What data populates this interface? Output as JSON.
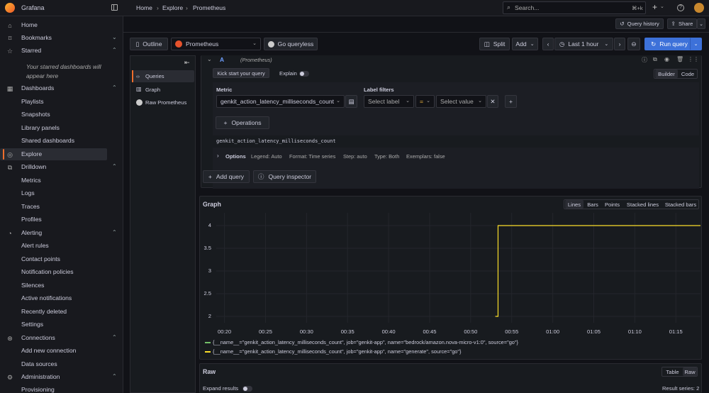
{
  "topbar": {
    "app_name": "Grafana",
    "breadcrumb": [
      "Home",
      "Explore",
      "Prometheus"
    ],
    "search_placeholder": "Search...",
    "search_shortcut": "⌘+k",
    "plus_label": "+"
  },
  "sidebar": {
    "items": [
      {
        "label": "Home",
        "icon": "home-icon",
        "chev": ""
      },
      {
        "label": "Bookmarks",
        "icon": "bookmark-icon",
        "chev": "⌄"
      },
      {
        "label": "Starred",
        "icon": "star-icon",
        "chev": "⌃"
      },
      {
        "label": "Dashboards",
        "icon": "dashboards-icon",
        "chev": "⌃"
      },
      {
        "label": "Playlists",
        "icon": "",
        "chev": ""
      },
      {
        "label": "Snapshots",
        "icon": "",
        "chev": ""
      },
      {
        "label": "Library panels",
        "icon": "",
        "chev": ""
      },
      {
        "label": "Shared dashboards",
        "icon": "",
        "chev": ""
      },
      {
        "label": "Explore",
        "icon": "explore-icon",
        "chev": ""
      },
      {
        "label": "Drilldown",
        "icon": "drilldown-icon",
        "chev": "⌃"
      },
      {
        "label": "Metrics",
        "icon": "",
        "chev": ""
      },
      {
        "label": "Logs",
        "icon": "",
        "chev": ""
      },
      {
        "label": "Traces",
        "icon": "",
        "chev": ""
      },
      {
        "label": "Profiles",
        "icon": "",
        "chev": ""
      },
      {
        "label": "Alerting",
        "icon": "bell-icon",
        "chev": "⌃"
      },
      {
        "label": "Alert rules",
        "icon": "",
        "chev": ""
      },
      {
        "label": "Contact points",
        "icon": "",
        "chev": ""
      },
      {
        "label": "Notification policies",
        "icon": "",
        "chev": ""
      },
      {
        "label": "Silences",
        "icon": "",
        "chev": ""
      },
      {
        "label": "Active notifications",
        "icon": "",
        "chev": ""
      },
      {
        "label": "Recently deleted",
        "icon": "",
        "chev": ""
      },
      {
        "label": "Settings",
        "icon": "",
        "chev": ""
      },
      {
        "label": "Connections",
        "icon": "connections-icon",
        "chev": "⌃"
      },
      {
        "label": "Add new connection",
        "icon": "",
        "chev": ""
      },
      {
        "label": "Data sources",
        "icon": "",
        "chev": ""
      },
      {
        "label": "Administration",
        "icon": "gear-icon",
        "chev": "⌃"
      },
      {
        "label": "Provisioning",
        "icon": "",
        "chev": ""
      }
    ],
    "starred_empty": "Your starred dashboards will appear here"
  },
  "actions": {
    "query_history": "Query history",
    "share": "Share"
  },
  "toolbar": {
    "outline": "Outline",
    "datasource": "Prometheus",
    "go_queryless": "Go queryless",
    "split": "Split",
    "add": "Add",
    "time_range": "Last 1 hour",
    "run_query": "Run query"
  },
  "outline_panel": {
    "items": [
      "Queries",
      "Graph",
      "Raw Prometheus"
    ]
  },
  "query": {
    "ref": "A",
    "datasource_label": "(Prometheus)",
    "kick_start": "Kick start your query",
    "explain": "Explain",
    "modes": [
      "Builder",
      "Code"
    ],
    "metric_label": "Metric",
    "metric_value": "genkit_action_latency_milliseconds_count",
    "label_filters_label": "Label filters",
    "label_placeholder": "Select label",
    "operator": "=",
    "value_placeholder": "Select value",
    "operations": "Operations",
    "preview": "genkit_action_latency_milliseconds_count",
    "options_title": "Options",
    "options": [
      "Legend: Auto",
      "Format: Time series",
      "Step: auto",
      "Type: Both",
      "Exemplars: false"
    ],
    "add_query": "Add query",
    "query_inspector": "Query inspector"
  },
  "graph": {
    "title": "Graph",
    "modes": [
      "Lines",
      "Bars",
      "Points",
      "Stacked lines",
      "Stacked bars"
    ]
  },
  "raw": {
    "title": "Raw",
    "modes": [
      "Table",
      "Raw"
    ],
    "expand_results": "Expand results",
    "result_series": "Result series: 2"
  },
  "chart_data": {
    "type": "line",
    "ylim": [
      1.9,
      4.15
    ],
    "y_ticks": [
      2,
      2.5,
      3,
      3.5,
      4
    ],
    "y_tick_labels": [
      "2",
      "2.5",
      "3",
      "3.5",
      "4"
    ],
    "x_ticks": [
      "00:20",
      "00:25",
      "00:30",
      "00:35",
      "00:40",
      "00:45",
      "00:50",
      "00:55",
      "01:00",
      "01:05",
      "01:10",
      "01:15"
    ],
    "x_range": [
      "00:19",
      "01:18"
    ],
    "series": [
      {
        "name": "{__name__=\"genkit_action_latency_milliseconds_count\", job=\"genkit-app\", name=\"bedrock/amazon.nova-micro-v1:0\", source=\"go\"}",
        "color": "#73bf69",
        "x": [],
        "values": []
      },
      {
        "name": "{__name__=\"genkit_action_latency_milliseconds_count\", job=\"genkit-app\", name=\"generate\", source=\"go\"}",
        "color": "#fade2a",
        "x": [
          "00:53",
          "00:53:20",
          "00:53:20",
          "01:18"
        ],
        "values": [
          2,
          2,
          4,
          4
        ]
      }
    ]
  }
}
